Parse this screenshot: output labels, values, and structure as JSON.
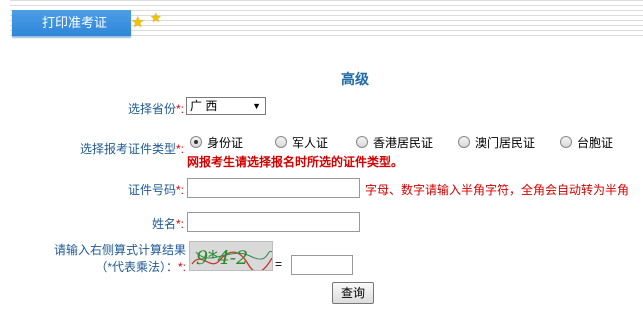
{
  "tab": {
    "label": "打印准考证"
  },
  "title": "高级",
  "province": {
    "label": "选择省份",
    "required": "*:",
    "value": "广 西"
  },
  "id_type": {
    "label": "选择报考证件类型",
    "required": "*:",
    "options": [
      {
        "label": "身份证",
        "checked": true
      },
      {
        "label": "军人证",
        "checked": false
      },
      {
        "label": "香港居民证",
        "checked": false
      },
      {
        "label": "澳门居民证",
        "checked": false
      },
      {
        "label": "台胞证",
        "checked": false
      }
    ],
    "warning": "网报考生请选择报名时所选的证件类型。"
  },
  "id_number": {
    "label": "证件号码",
    "required": "*:",
    "value": "",
    "hint": "字母、数字请输入半角字符，全角会自动转为半角"
  },
  "name": {
    "label": "姓名",
    "required": "*:",
    "value": ""
  },
  "captcha": {
    "label_line1": "请输入右侧算式计算结果",
    "label_line2": "（*代表乘法）：",
    "required": "*:",
    "image_text": "9*4-2",
    "equals": "=",
    "value": ""
  },
  "submit_label": "查询",
  "colors": {
    "tab": "#2f86d8",
    "label": "#1f5b94",
    "warning": "#d40000",
    "star": "#f2c200"
  }
}
